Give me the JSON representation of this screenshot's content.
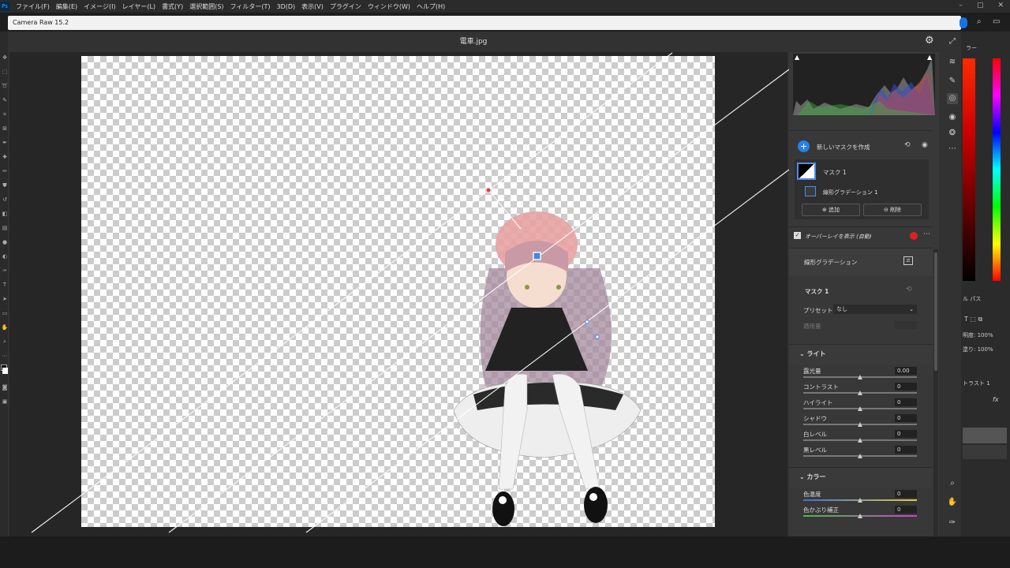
{
  "menubar": {
    "app_icon": "Ps",
    "items": [
      "ファイル(F)",
      "編集(E)",
      "イメージ(I)",
      "レイヤー(L)",
      "書式(Y)",
      "選択範囲(S)",
      "フィルター(T)",
      "3D(D)",
      "表示(V)",
      "プラグイン",
      "ウィンドウ(W)",
      "ヘルプ(H)"
    ],
    "window_controls": [
      "–",
      "▢",
      "✕"
    ]
  },
  "dialog": {
    "title": "Camera Raw 15.2",
    "filename": "電車.jpg",
    "settings_icon": "gear-icon"
  },
  "mask_panel": {
    "create_label": "新しいマスクを作成",
    "mask_name": "マスク 1",
    "component_name": "線形グラデーション 1",
    "add_label": "追加",
    "delete_label": "削除",
    "overlay_label": "オーバーレイを表示 (自動)",
    "overlay_color": "#e02020"
  },
  "tool_row": {
    "label": "線形グラデーション"
  },
  "adjust": {
    "mask_title": "マスク 1",
    "preset_label": "プリセット",
    "preset_value": "なし",
    "amount_label": "適用量"
  },
  "light": {
    "title": "ライト",
    "sliders": [
      {
        "label": "露光量",
        "value": "0.00",
        "position": 0.5
      },
      {
        "label": "コントラスト",
        "value": "0",
        "position": 0.5
      },
      {
        "label": "ハイライト",
        "value": "0",
        "position": 0.5
      },
      {
        "label": "シャドウ",
        "value": "0",
        "position": 0.5
      },
      {
        "label": "白レベル",
        "value": "0",
        "position": 0.5
      },
      {
        "label": "黒レベル",
        "value": "0",
        "position": 0.5
      }
    ]
  },
  "color": {
    "title": "カラー",
    "sliders": [
      {
        "label": "色温度",
        "value": "0",
        "position": 0.5
      },
      {
        "label": "色かぶり補正",
        "value": "0",
        "position": 0.5
      }
    ]
  },
  "ps_right": {
    "tab_label": "ラー",
    "opacity_label": "明度:",
    "opacity_value": "100%",
    "fill_label": "塗り:",
    "fill_value": "100%",
    "layer_name": "トラスト 1",
    "tab2": "ル  パス"
  }
}
